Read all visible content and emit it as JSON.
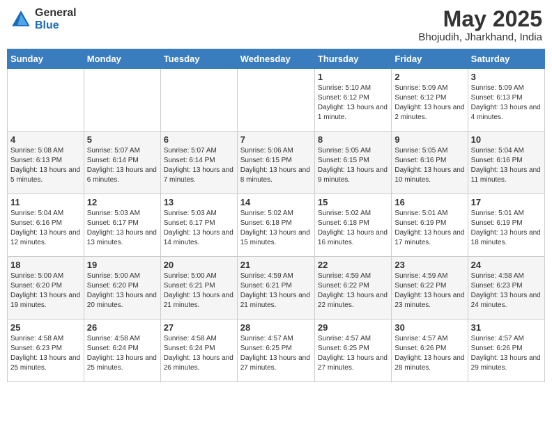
{
  "header": {
    "logo_general": "General",
    "logo_blue": "Blue",
    "month_title": "May 2025",
    "location": "Bhojudih, Jharkhand, India"
  },
  "days_of_week": [
    "Sunday",
    "Monday",
    "Tuesday",
    "Wednesday",
    "Thursday",
    "Friday",
    "Saturday"
  ],
  "weeks": [
    [
      {
        "num": "",
        "info": ""
      },
      {
        "num": "",
        "info": ""
      },
      {
        "num": "",
        "info": ""
      },
      {
        "num": "",
        "info": ""
      },
      {
        "num": "1",
        "info": "Sunrise: 5:10 AM\nSunset: 6:12 PM\nDaylight: 13 hours and 1 minute."
      },
      {
        "num": "2",
        "info": "Sunrise: 5:09 AM\nSunset: 6:12 PM\nDaylight: 13 hours and 2 minutes."
      },
      {
        "num": "3",
        "info": "Sunrise: 5:09 AM\nSunset: 6:13 PM\nDaylight: 13 hours and 4 minutes."
      }
    ],
    [
      {
        "num": "4",
        "info": "Sunrise: 5:08 AM\nSunset: 6:13 PM\nDaylight: 13 hours and 5 minutes."
      },
      {
        "num": "5",
        "info": "Sunrise: 5:07 AM\nSunset: 6:14 PM\nDaylight: 13 hours and 6 minutes."
      },
      {
        "num": "6",
        "info": "Sunrise: 5:07 AM\nSunset: 6:14 PM\nDaylight: 13 hours and 7 minutes."
      },
      {
        "num": "7",
        "info": "Sunrise: 5:06 AM\nSunset: 6:15 PM\nDaylight: 13 hours and 8 minutes."
      },
      {
        "num": "8",
        "info": "Sunrise: 5:05 AM\nSunset: 6:15 PM\nDaylight: 13 hours and 9 minutes."
      },
      {
        "num": "9",
        "info": "Sunrise: 5:05 AM\nSunset: 6:16 PM\nDaylight: 13 hours and 10 minutes."
      },
      {
        "num": "10",
        "info": "Sunrise: 5:04 AM\nSunset: 6:16 PM\nDaylight: 13 hours and 11 minutes."
      }
    ],
    [
      {
        "num": "11",
        "info": "Sunrise: 5:04 AM\nSunset: 6:16 PM\nDaylight: 13 hours and 12 minutes."
      },
      {
        "num": "12",
        "info": "Sunrise: 5:03 AM\nSunset: 6:17 PM\nDaylight: 13 hours and 13 minutes."
      },
      {
        "num": "13",
        "info": "Sunrise: 5:03 AM\nSunset: 6:17 PM\nDaylight: 13 hours and 14 minutes."
      },
      {
        "num": "14",
        "info": "Sunrise: 5:02 AM\nSunset: 6:18 PM\nDaylight: 13 hours and 15 minutes."
      },
      {
        "num": "15",
        "info": "Sunrise: 5:02 AM\nSunset: 6:18 PM\nDaylight: 13 hours and 16 minutes."
      },
      {
        "num": "16",
        "info": "Sunrise: 5:01 AM\nSunset: 6:19 PM\nDaylight: 13 hours and 17 minutes."
      },
      {
        "num": "17",
        "info": "Sunrise: 5:01 AM\nSunset: 6:19 PM\nDaylight: 13 hours and 18 minutes."
      }
    ],
    [
      {
        "num": "18",
        "info": "Sunrise: 5:00 AM\nSunset: 6:20 PM\nDaylight: 13 hours and 19 minutes."
      },
      {
        "num": "19",
        "info": "Sunrise: 5:00 AM\nSunset: 6:20 PM\nDaylight: 13 hours and 20 minutes."
      },
      {
        "num": "20",
        "info": "Sunrise: 5:00 AM\nSunset: 6:21 PM\nDaylight: 13 hours and 21 minutes."
      },
      {
        "num": "21",
        "info": "Sunrise: 4:59 AM\nSunset: 6:21 PM\nDaylight: 13 hours and 21 minutes."
      },
      {
        "num": "22",
        "info": "Sunrise: 4:59 AM\nSunset: 6:22 PM\nDaylight: 13 hours and 22 minutes."
      },
      {
        "num": "23",
        "info": "Sunrise: 4:59 AM\nSunset: 6:22 PM\nDaylight: 13 hours and 23 minutes."
      },
      {
        "num": "24",
        "info": "Sunrise: 4:58 AM\nSunset: 6:23 PM\nDaylight: 13 hours and 24 minutes."
      }
    ],
    [
      {
        "num": "25",
        "info": "Sunrise: 4:58 AM\nSunset: 6:23 PM\nDaylight: 13 hours and 25 minutes."
      },
      {
        "num": "26",
        "info": "Sunrise: 4:58 AM\nSunset: 6:24 PM\nDaylight: 13 hours and 25 minutes."
      },
      {
        "num": "27",
        "info": "Sunrise: 4:58 AM\nSunset: 6:24 PM\nDaylight: 13 hours and 26 minutes."
      },
      {
        "num": "28",
        "info": "Sunrise: 4:57 AM\nSunset: 6:25 PM\nDaylight: 13 hours and 27 minutes."
      },
      {
        "num": "29",
        "info": "Sunrise: 4:57 AM\nSunset: 6:25 PM\nDaylight: 13 hours and 27 minutes."
      },
      {
        "num": "30",
        "info": "Sunrise: 4:57 AM\nSunset: 6:26 PM\nDaylight: 13 hours and 28 minutes."
      },
      {
        "num": "31",
        "info": "Sunrise: 4:57 AM\nSunset: 6:26 PM\nDaylight: 13 hours and 29 minutes."
      }
    ]
  ]
}
